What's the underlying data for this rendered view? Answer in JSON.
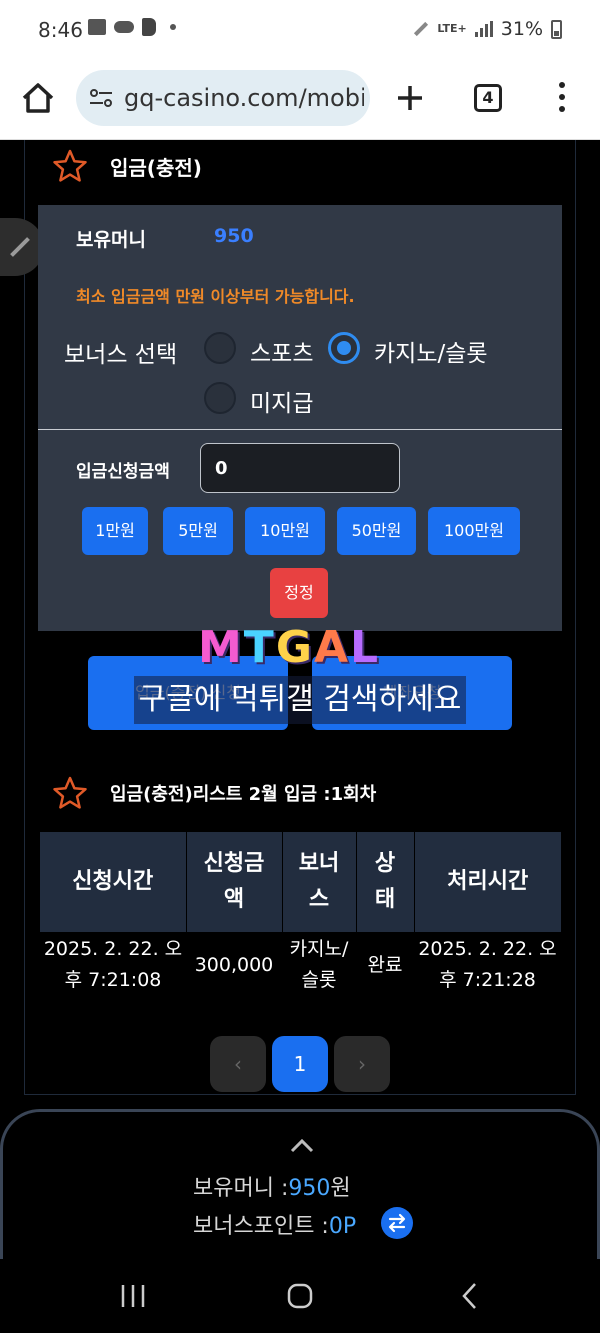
{
  "status_bar": {
    "time": "8:46",
    "network": "LTE+",
    "battery": "31%",
    "icons": [
      "gallery-icon",
      "cloud-icon",
      "b-app-icon",
      "dot-icon",
      "pen-icon",
      "signal-icon",
      "battery-icon"
    ]
  },
  "browser": {
    "url": "gq-casino.com/mobi",
    "tab_count": "4"
  },
  "deposit": {
    "section_title": "입금(충전)",
    "money_label": "보유머니",
    "money_value": "950",
    "notice": "최소 입금금액 만원 이상부터 가능합니다.",
    "bonus_label": "보너스 선택",
    "bonus_options": [
      {
        "label": "스포츠",
        "checked": false
      },
      {
        "label": "카지노/슬롯",
        "checked": true
      },
      {
        "label": "미지급",
        "checked": false
      }
    ],
    "amount_label": "입금신청금액",
    "amount_value": "0",
    "quick_amounts": [
      "1만원",
      "5만원",
      "10만원",
      "50만원",
      "100만원"
    ],
    "reset_label": "정정",
    "submit_label": "입금(충전) 신청",
    "account_label": "계좌요청"
  },
  "watermark": {
    "logo": [
      "M",
      "T",
      "G",
      "A",
      "L"
    ],
    "text": "구글에 먹튀갤 검색하세요"
  },
  "history": {
    "section_title": "입금(충전)리스트 2월 입금 :1회차",
    "columns": [
      [
        "신청시간"
      ],
      [
        "신청금",
        "액"
      ],
      [
        "보너",
        "스"
      ],
      [
        "상",
        "태"
      ],
      [
        "처리시간"
      ]
    ],
    "rows": [
      {
        "request_time": [
          "2025. 2. 22. 오",
          "후 7:21:08"
        ],
        "amount": "300,000",
        "bonus": [
          "카지노/",
          "슬롯"
        ],
        "status": "완료",
        "processed_time": [
          "2025. 2. 22. 오",
          "후 7:21:28"
        ]
      }
    ],
    "pagination": {
      "prev": "‹",
      "current": "1",
      "next": "›"
    }
  },
  "bottom_panel": {
    "money_label": "보유머니 :",
    "money_value": "950",
    "money_unit": "원",
    "points_label": "보너스포인트 :",
    "points_value": "0P"
  },
  "colors": {
    "accent_blue": "#1a6ff0",
    "warning_orange": "#f08a28",
    "danger_red": "#e84141",
    "panel_bg": "#313946",
    "table_header_bg": "#222d3f"
  }
}
